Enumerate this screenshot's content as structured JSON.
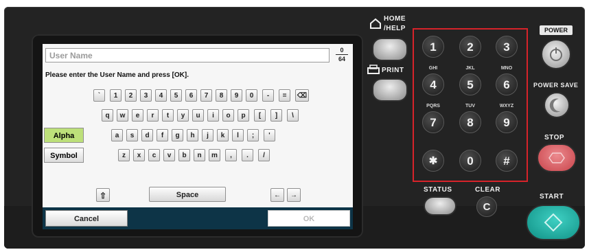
{
  "screen": {
    "input": {
      "placeholder": "User Name"
    },
    "counter": {
      "current": "0",
      "max": "64"
    },
    "prompt": "Please enter the User Name and press [OK].",
    "keys_row1": [
      "`",
      "1",
      "2",
      "3",
      "4",
      "5",
      "6",
      "7",
      "8",
      "9",
      "0",
      "-",
      "="
    ],
    "backspace": "⌫",
    "keys_row2": [
      "q",
      "w",
      "e",
      "r",
      "t",
      "y",
      "u",
      "i",
      "o",
      "p",
      "[",
      "]",
      "\\"
    ],
    "keys_row3": [
      "a",
      "s",
      "d",
      "f",
      "g",
      "h",
      "j",
      "k",
      "l",
      ";",
      "'"
    ],
    "keys_row4": [
      "z",
      "x",
      "c",
      "v",
      "b",
      "n",
      "m",
      ",",
      ".",
      "/"
    ],
    "mode_alpha": "Alpha",
    "mode_symbol": "Symbol",
    "shift": "⇧",
    "space": "Space",
    "arrow_left": "←",
    "arrow_right": "→",
    "cancel": "Cancel",
    "ok": "OK"
  },
  "side": {
    "home_label_1": "HOME",
    "home_label_2": "/HELP",
    "print_label": "PRINT",
    "status_label": "STATUS",
    "clear_label": "CLEAR",
    "clear_key": "C"
  },
  "keypad": {
    "keys": [
      "1",
      "2",
      "3",
      "4",
      "5",
      "6",
      "7",
      "8",
      "9",
      "✱",
      "0",
      "#"
    ],
    "letters": [
      "",
      "",
      "",
      "GHI",
      "JKL",
      "MNO",
      "PQRS",
      "TUV",
      "WXYZ",
      "",
      "",
      ""
    ]
  },
  "right": {
    "power": "POWER",
    "power_save": "POWER SAVE",
    "stop": "STOP",
    "start": "START"
  },
  "colors": {
    "keypad_frame": "#d8232a",
    "alpha_active": "#bde07a",
    "bottom_bar": "#0d3447",
    "stop": "#d9535a",
    "start": "#1aa89c"
  }
}
